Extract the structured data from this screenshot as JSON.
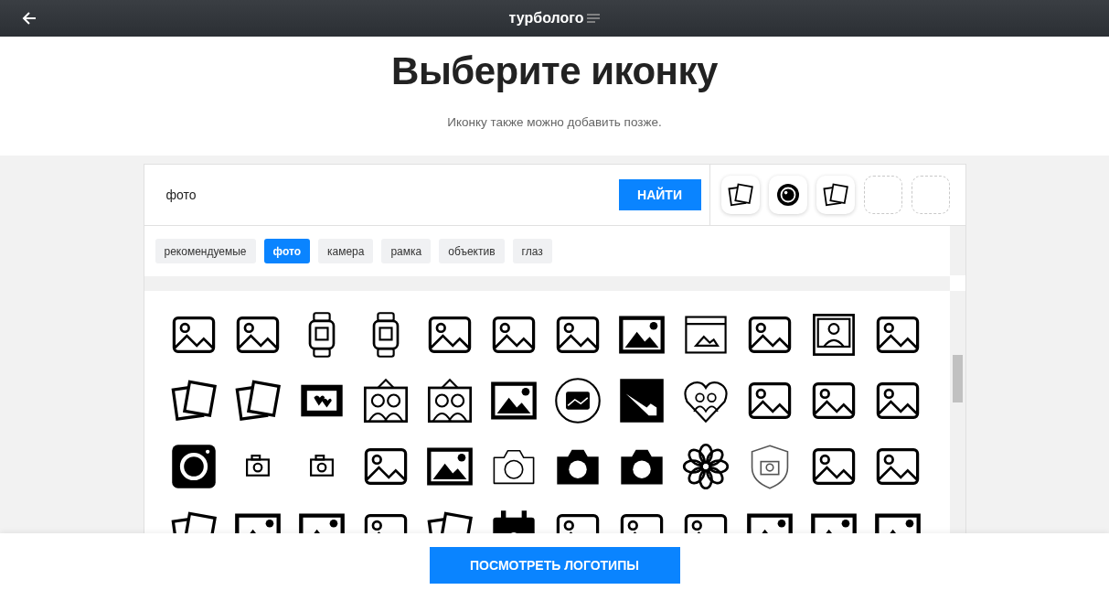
{
  "top_bar": {
    "logo": "турболого"
  },
  "header": {
    "title": "Выберите иконку",
    "subtitle": "Иконку также можно добавить позже."
  },
  "search": {
    "value": "фото",
    "button": "НАЙТИ"
  },
  "chosen_slots": [
    {
      "kind": "photo-stack"
    },
    {
      "kind": "lens"
    },
    {
      "kind": "photo-stack"
    },
    {
      "kind": "empty"
    },
    {
      "kind": "empty"
    }
  ],
  "tags": [
    {
      "label": "рекомендуемые",
      "selected": false
    },
    {
      "label": "фото",
      "selected": true
    },
    {
      "label": "камера",
      "selected": false
    },
    {
      "label": "рамка",
      "selected": false
    },
    {
      "label": "объектив",
      "selected": false
    },
    {
      "label": "глаз",
      "selected": false
    }
  ],
  "icons": [
    {
      "kind": "image-outline"
    },
    {
      "kind": "image-outline"
    },
    {
      "kind": "watch"
    },
    {
      "kind": "watch"
    },
    {
      "kind": "image-outline"
    },
    {
      "kind": "image-outline"
    },
    {
      "kind": "image-outline"
    },
    {
      "kind": "image-filled"
    },
    {
      "kind": "browser"
    },
    {
      "kind": "image-outline"
    },
    {
      "kind": "portrait"
    },
    {
      "kind": "image-outline"
    },
    {
      "kind": "photo-stack"
    },
    {
      "kind": "photo-stack"
    },
    {
      "kind": "hearts-frame"
    },
    {
      "kind": "couple"
    },
    {
      "kind": "couple"
    },
    {
      "kind": "image-filled"
    },
    {
      "kind": "circle-image"
    },
    {
      "kind": "corner-image"
    },
    {
      "kind": "heart-couple"
    },
    {
      "kind": "image-outline"
    },
    {
      "kind": "image-outline"
    },
    {
      "kind": "image-outline"
    },
    {
      "kind": "camera-square"
    },
    {
      "kind": "camera-small"
    },
    {
      "kind": "camera-small"
    },
    {
      "kind": "image-outline"
    },
    {
      "kind": "image-filled"
    },
    {
      "kind": "camera-outline"
    },
    {
      "kind": "camera-filled"
    },
    {
      "kind": "camera-filled"
    },
    {
      "kind": "flower"
    },
    {
      "kind": "shield-camera"
    },
    {
      "kind": "image-outline"
    },
    {
      "kind": "image-outline"
    },
    {
      "kind": "photo-stack"
    },
    {
      "kind": "image-filled"
    },
    {
      "kind": "image-filled"
    },
    {
      "kind": "image-outline"
    },
    {
      "kind": "photo-stack"
    },
    {
      "kind": "calendar-image"
    },
    {
      "kind": "image-outline"
    },
    {
      "kind": "image-outline"
    },
    {
      "kind": "image-outline"
    },
    {
      "kind": "image-filled"
    },
    {
      "kind": "image-filled"
    },
    {
      "kind": "image-filled"
    }
  ],
  "footer": {
    "button": "ПОСМОТРЕТЬ ЛОГОТИПЫ"
  }
}
